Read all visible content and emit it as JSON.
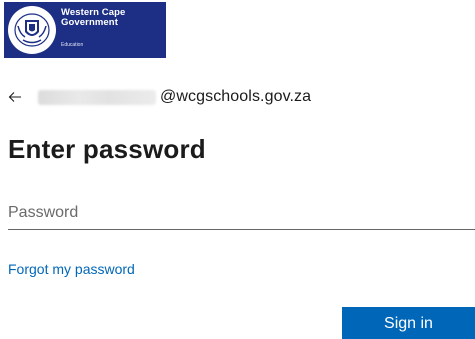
{
  "logo": {
    "line1": "Western Cape",
    "line2": "Government",
    "department": "Education",
    "background_color": "#1c2f85"
  },
  "identity": {
    "back_icon": "arrow-left-icon",
    "email_domain": "@wcgschools.gov.za"
  },
  "heading": "Enter password",
  "password_field": {
    "placeholder": "Password",
    "value": ""
  },
  "forgot_link": "Forgot my password",
  "sign_in_button": "Sign in",
  "colors": {
    "accent": "#0067b8",
    "text": "#1b1b1b"
  }
}
